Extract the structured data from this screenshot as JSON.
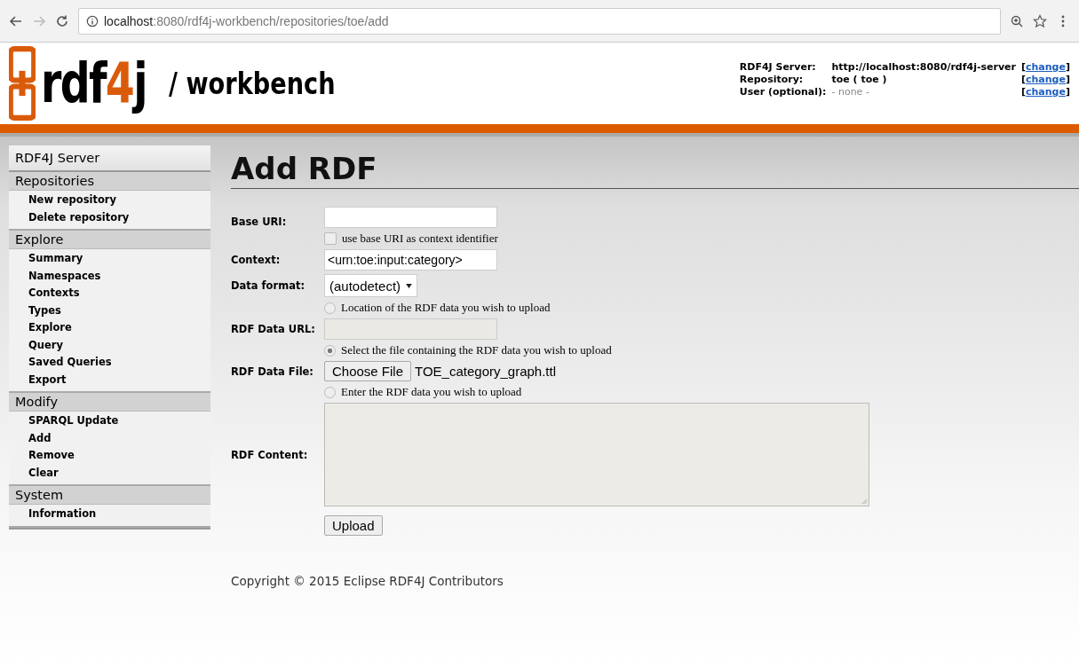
{
  "browser": {
    "url_host": "localhost",
    "url_path": ":8080/rdf4j-workbench/repositories/toe/add"
  },
  "header": {
    "logo_parts": [
      {
        "text": "rdf",
        "accent": false
      },
      {
        "text": "4",
        "accent": true
      },
      {
        "text": "j",
        "accent": false
      }
    ],
    "subtitle": "/ workbench",
    "info": [
      {
        "label": "RDF4J Server:",
        "value": "http://localhost:8080/rdf4j-server",
        "muted": false,
        "open": "[",
        "link": "change",
        "close": "]"
      },
      {
        "label": "Repository:",
        "value": "toe ( toe )",
        "muted": false,
        "open": "[",
        "link": "change",
        "close": "]"
      },
      {
        "label": "User (optional):",
        "value": "- none -",
        "muted": true,
        "open": "[",
        "link": "change",
        "close": "]"
      }
    ]
  },
  "sidebar": [
    {
      "heading": "RDF4J Server",
      "top": true
    },
    {
      "heading": "Repositories",
      "top": false,
      "items": [
        "New repository",
        "Delete repository"
      ]
    },
    {
      "heading": "Explore",
      "top": false,
      "items": [
        "Summary",
        "Namespaces",
        "Contexts",
        "Types",
        "Explore",
        "Query",
        "Saved Queries",
        "Export"
      ]
    },
    {
      "heading": "Modify",
      "top": false,
      "items": [
        "SPARQL Update",
        "Add",
        "Remove",
        "Clear"
      ]
    },
    {
      "heading": "System",
      "top": false,
      "items": [
        "Information"
      ]
    }
  ],
  "page_title": "Add RDF",
  "form": [
    {
      "kind": "text",
      "label": "Base URI:",
      "disabled": false
    },
    {
      "kind": "checkbox",
      "text": "use base URI as context identifier",
      "checked": false
    },
    {
      "kind": "text",
      "label": "Context:",
      "value": "<urn:toe:input:category>",
      "disabled": false
    },
    {
      "kind": "select",
      "label": "Data format:",
      "value": "(autodetect)"
    },
    {
      "kind": "radio",
      "text": "Location of the RDF data you wish to upload",
      "selected": false
    },
    {
      "kind": "text",
      "label": "RDF Data URL:",
      "disabled": true
    },
    {
      "kind": "radio",
      "text": "Select the file containing the RDF data you wish to upload",
      "selected": true
    },
    {
      "kind": "file",
      "label": "RDF Data File:",
      "button": "Choose File",
      "filename": "TOE_category_graph.ttl"
    },
    {
      "kind": "radio",
      "text": "Enter the RDF data you wish to upload",
      "selected": false
    },
    {
      "kind": "textarea",
      "label": "RDF Content:",
      "disabled": true
    },
    {
      "kind": "submit",
      "button": "Upload"
    }
  ],
  "footer": "Copyright © 2015 Eclipse RDF4J Contributors"
}
